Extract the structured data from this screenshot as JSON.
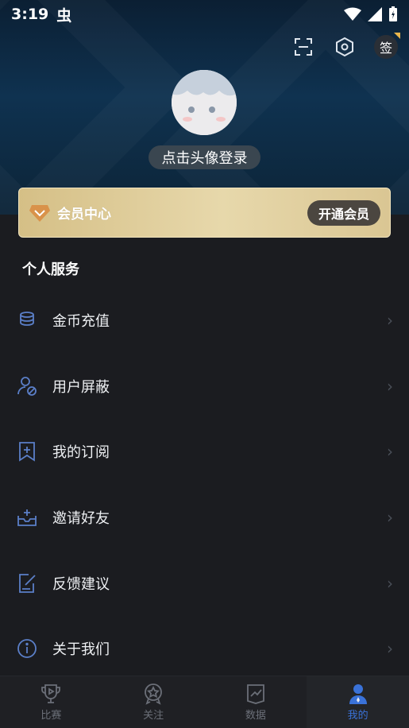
{
  "status_bar": {
    "time": "3:19",
    "app_glyph": "虫"
  },
  "header": {
    "scan_icon": "scan-icon",
    "settings_icon": "settings-hex-icon",
    "sign_label": "签"
  },
  "profile": {
    "login_text": "点击头像登录"
  },
  "vip": {
    "title": "会员中心",
    "open_label": "开通会员"
  },
  "services": {
    "section_title": "个人服务",
    "items": [
      {
        "label": "金币充值",
        "icon": "coins-stack-icon"
      },
      {
        "label": "用户屏蔽",
        "icon": "user-block-icon"
      },
      {
        "label": "我的订阅",
        "icon": "bookmark-add-icon"
      },
      {
        "label": "邀请好友",
        "icon": "invite-inbox-icon"
      },
      {
        "label": "反馈建议",
        "icon": "feedback-edit-icon"
      },
      {
        "label": "关于我们",
        "icon": "info-circle-icon"
      }
    ]
  },
  "tabs": [
    {
      "label": "比赛",
      "icon": "trophy-play-icon",
      "active": false
    },
    {
      "label": "关注",
      "icon": "star-badge-icon",
      "active": false
    },
    {
      "label": "数据",
      "icon": "chart-doc-icon",
      "active": false
    },
    {
      "label": "我的",
      "icon": "user-icon",
      "active": true
    }
  ],
  "colors": {
    "accent": "#3a72d8",
    "gold": "#d5bf86",
    "background": "#1b1c20"
  }
}
